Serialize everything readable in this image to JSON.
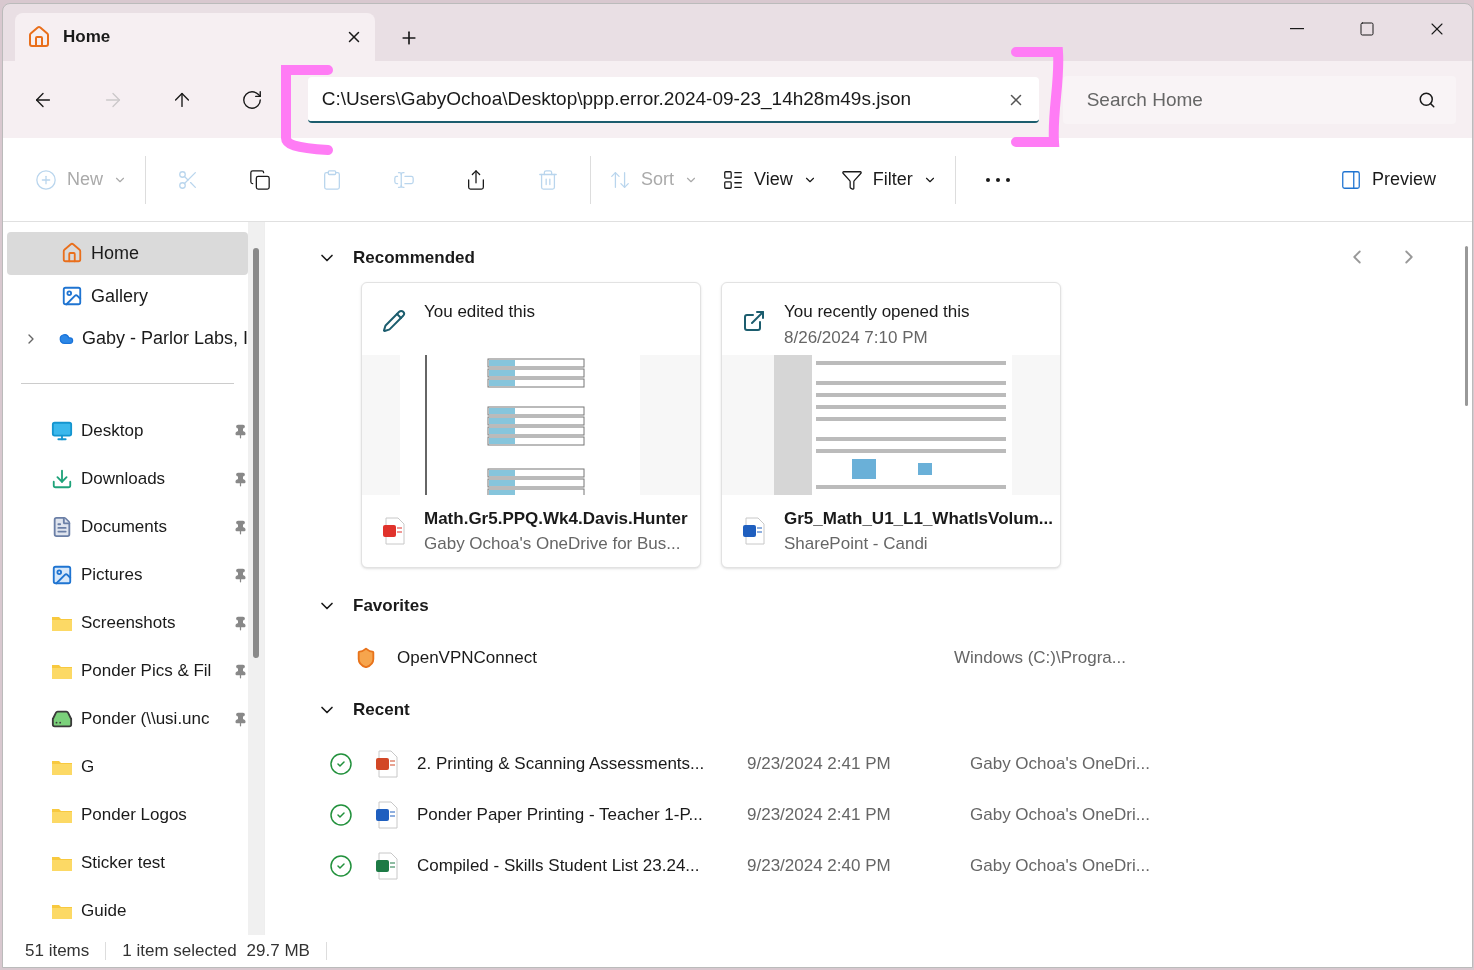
{
  "tab": {
    "title": "Home",
    "selected": true
  },
  "nav": [
    {
      "kind": "back",
      "disabled": false
    },
    {
      "kind": "forward",
      "disabled": true
    },
    {
      "kind": "up",
      "disabled": false
    },
    {
      "kind": "refresh",
      "disabled": false
    }
  ],
  "address": {
    "value": "C:\\Users\\GabyOchoa\\Desktop\\ppp.error.2024-09-23_14h28m49s.json"
  },
  "search": {
    "placeholder": "Search Home"
  },
  "toolbar": [
    {
      "kind": "new",
      "label": "New",
      "dropdown": true,
      "disabled": true
    },
    {
      "kind": "cut",
      "disabled": true
    },
    {
      "kind": "copy",
      "disabled": false
    },
    {
      "kind": "paste",
      "disabled": true
    },
    {
      "kind": "rename",
      "disabled": true
    },
    {
      "kind": "share",
      "disabled": false
    },
    {
      "kind": "delete",
      "disabled": true
    },
    {
      "kind": "sort",
      "label": "Sort",
      "dropdown": true,
      "disabled": true
    },
    {
      "kind": "view",
      "label": "View",
      "dropdown": true,
      "disabled": false
    },
    {
      "kind": "filter",
      "label": "Filter",
      "dropdown": true,
      "disabled": false
    },
    {
      "kind": "more",
      "disabled": false
    }
  ],
  "preview": {
    "label": "Preview"
  },
  "sidebar": {
    "top": [
      {
        "kind": "home",
        "label": "Home",
        "selected": true,
        "expandable": false
      },
      {
        "kind": "gallery",
        "label": "Gallery",
        "selected": false,
        "expandable": false
      },
      {
        "kind": "cloud",
        "label": "Gaby - Parlor Labs, I",
        "selected": false,
        "expandable": true
      }
    ],
    "quick": [
      {
        "kind": "desktop",
        "label": "Desktop",
        "pinned": true
      },
      {
        "kind": "downloads",
        "label": "Downloads",
        "pinned": true
      },
      {
        "kind": "documents",
        "label": "Documents",
        "pinned": true
      },
      {
        "kind": "pictures",
        "label": "Pictures",
        "pinned": true
      },
      {
        "kind": "folder",
        "label": "Screenshots",
        "pinned": true
      },
      {
        "kind": "folder",
        "label": "Ponder Pics & Fil",
        "pinned": true
      },
      {
        "kind": "drive",
        "label": "Ponder (\\\\usi.unc",
        "pinned": true
      },
      {
        "kind": "folder",
        "label": "G",
        "pinned": false
      },
      {
        "kind": "folder",
        "label": "Ponder Logos",
        "pinned": false
      },
      {
        "kind": "folder",
        "label": "Sticker test",
        "pinned": false
      },
      {
        "kind": "folder",
        "label": "Guide",
        "pinned": false
      }
    ]
  },
  "recommended": {
    "title": "Recommended",
    "expanded": true,
    "cards": [
      {
        "kind": "edited",
        "heading": "You edited this",
        "file": {
          "kind": "pdf",
          "name": "Math.Gr5.PPQ.Wk4.Davis.Hunter",
          "location": "Gaby Ochoa's OneDrive for Bus..."
        }
      },
      {
        "kind": "opened",
        "heading": "You recently opened this",
        "date": "8/26/2024 7:10 PM",
        "file": {
          "kind": "word",
          "name": "Gr5_Math_U1_L1_WhatIsVolum...",
          "location": "SharePoint - Candi"
        }
      }
    ]
  },
  "favorites": {
    "title": "Favorites",
    "expanded": true,
    "items": [
      {
        "name": "OpenVPNConnect",
        "location": "Windows (C:)\\Progra..."
      }
    ]
  },
  "recent": {
    "title": "Recent",
    "expanded": true,
    "items": [
      {
        "kind": "powerpoint",
        "synced": true,
        "name": "2. Printing & Scanning Assessments...",
        "date": "9/23/2024 2:41 PM",
        "location": "Gaby Ochoa's OneDri..."
      },
      {
        "kind": "word",
        "synced": true,
        "name": "Ponder Paper Printing - Teacher 1-P...",
        "date": "9/23/2024 2:41 PM",
        "location": "Gaby Ochoa's OneDri..."
      },
      {
        "kind": "excel",
        "synced": true,
        "name": "Compiled - Skills Student List 23.24...",
        "date": "9/23/2024 2:40 PM",
        "location": "Gaby Ochoa's OneDri..."
      }
    ]
  },
  "status_bar": {
    "count": "51 items",
    "selection": "1 item selected",
    "size": "29.7 MB"
  }
}
